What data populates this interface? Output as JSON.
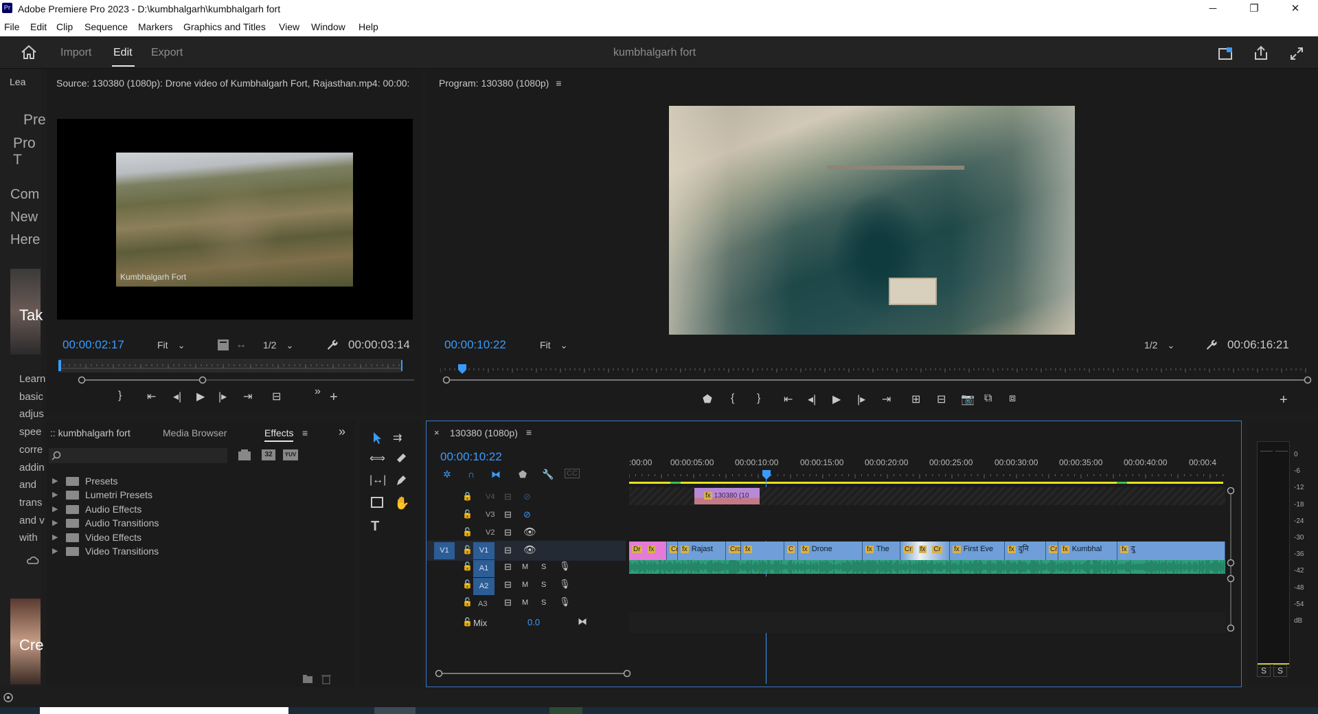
{
  "window": {
    "title": "Adobe Premiere Pro 2023 - D:\\kumbhalgarh\\kumbhalgarh fort",
    "app_icon_text": "Pr",
    "controls": [
      "─",
      "❐",
      "✕"
    ]
  },
  "menu": [
    "File",
    "Edit",
    "Clip",
    "Sequence",
    "Markers",
    "Graphics and Titles",
    "View",
    "Window",
    "Help"
  ],
  "workspace": {
    "tabs": [
      "Import",
      "Edit",
      "Export"
    ],
    "active": "Edit",
    "project_name": "kumbhalgarh fort"
  },
  "learn_panel": {
    "tab": "Lea",
    "lines": [
      "Pre",
      "Pro T",
      "Com",
      "New",
      "Here",
      "Tak",
      "Learn",
      "basic",
      "adjus",
      "spee",
      "corre",
      "addin",
      "and",
      "trans",
      "and v",
      "with",
      "Cre"
    ]
  },
  "source_monitor": {
    "header": "Source: 130380 (1080p): Drone video of Kumbhalgarh Fort, Rajasthan.mp4: 00:00:",
    "watermark": "Kumbhalgarh Fort",
    "timecode": "00:00:02:17",
    "fit": "Fit",
    "resolution": "1/2",
    "duration": "00:00:03:14"
  },
  "program_monitor": {
    "header": "Program: 130380 (1080p)",
    "timecode": "00:00:10:22",
    "fit": "Fit",
    "resolution": "1/2",
    "duration": "00:06:16:21"
  },
  "project_panel": {
    "tabs": [
      ":: kumbhalgarh fort",
      "Media Browser",
      "Effects"
    ],
    "active_tab": "Effects",
    "search_placeholder": "",
    "items": [
      "Presets",
      "Lumetri Presets",
      "Audio Effects",
      "Audio Transitions",
      "Video Effects",
      "Video Transitions"
    ],
    "icon_32": "32",
    "icon_yuv": "YUV"
  },
  "timeline": {
    "sequence_tab": "130380 (1080p)",
    "timecode": "00:00:10:22",
    "ruler": [
      ":00:00",
      "00:00:05:00",
      "00:00:10:00",
      "00:00:15:00",
      "00:00:20:00",
      "00:00:25:00",
      "00:00:30:00",
      "00:00:35:00",
      "00:00:40:00",
      "00:00:4"
    ],
    "video_tracks": [
      "V4",
      "V3",
      "V2",
      "V1"
    ],
    "audio_tracks": [
      "A1",
      "A2",
      "A3"
    ],
    "source_patch_v": "V1",
    "mix_label": "Mix",
    "mix_value": "0.0",
    "track_buttons": {
      "mute": "M",
      "solo": "S"
    },
    "v4_clip": "130380 (10",
    "v1_clips": [
      {
        "label": "Dr",
        "fx": "fx"
      },
      {
        "label": "Cr",
        "fx": "fx"
      },
      {
        "label": "Rajast",
        "fx": "fx"
      },
      {
        "label": "Cro",
        "fx": "fx"
      },
      {
        "label": "",
        "fx": "fx"
      },
      {
        "label": "C",
        "fx": ""
      },
      {
        "label": "Drone",
        "fx": "fx"
      },
      {
        "label": "The",
        "fx": "fx"
      },
      {
        "label": "Cr",
        "fx": "fx"
      },
      {
        "label": "Cr",
        "fx": "fx"
      },
      {
        "label": "First Eve",
        "fx": "fx"
      },
      {
        "label": "दुनि",
        "fx": "fx"
      },
      {
        "label": "Cr",
        "fx": ""
      },
      {
        "label": "Kumbhal",
        "fx": "fx"
      },
      {
        "label": "दु",
        "fx": "fx"
      }
    ]
  },
  "audio_meter": {
    "scale": [
      "0",
      "-6",
      "-12",
      "-18",
      "-24",
      "-30",
      "-36",
      "-42",
      "-48",
      "-54",
      "dB"
    ],
    "solo_buttons": [
      "S",
      "S"
    ]
  },
  "colors": {
    "accent_blue": "#3a9bff",
    "clip_blue": "#6f9ed8",
    "clip_pink": "#e57ad8",
    "audio_green": "#3fbf8a",
    "work_area_yellow": "#e6e21e",
    "panel_bg": "#1b1b1b"
  }
}
